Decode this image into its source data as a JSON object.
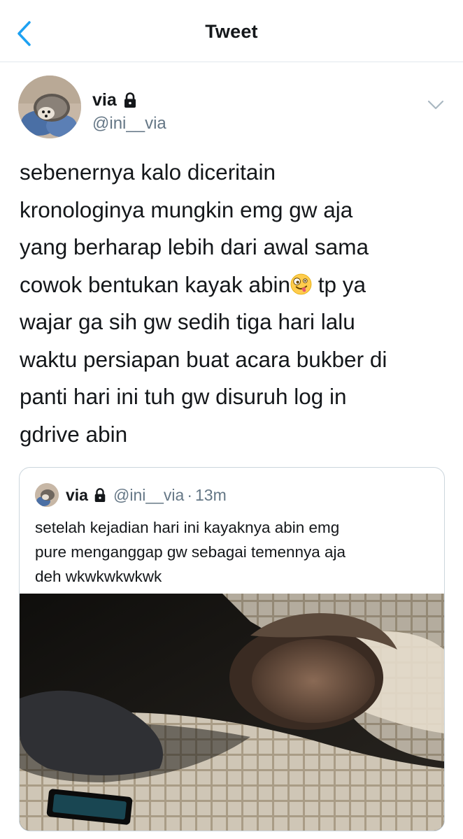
{
  "nav": {
    "title": "Tweet",
    "back_icon": "chevron-left-icon",
    "accent_color": "#1da1f2"
  },
  "tweet": {
    "author": {
      "display_name": "via",
      "handle": "@ini__via",
      "protected_icon": "lock-icon"
    },
    "lines": [
      "sebenernya kalo diceritain",
      "kronologinya mungkin emg gw aja",
      "yang berharap lebih dari awal sama",
      "cowok bentukan kayak abin",
      "wajar ga sih gw sedih tiga hari lalu",
      "waktu persiapan buat acara bukber di",
      "panti hari ini tuh gw disuruh log in",
      "gdrive abin"
    ],
    "line4_after_emoji": " tp ya",
    "emoji": "zany-face-emoji",
    "menu_icon": "chevron-down-icon"
  },
  "quoted_tweet": {
    "display_name": "via",
    "handle": "@ini__via",
    "separator": "·",
    "time": "13m",
    "lines": [
      "setelah kejadian hari ini kayaknya abin emg",
      "pure menganggap gw sebagai temennya aja",
      "deh wkwkwkwkwk"
    ],
    "media": "photo-person-sleeping-on-pillow"
  },
  "colors": {
    "text": "#14171a",
    "secondary_text": "#657786",
    "border": "#e1e8ed",
    "card_border": "#ccd6dd"
  }
}
